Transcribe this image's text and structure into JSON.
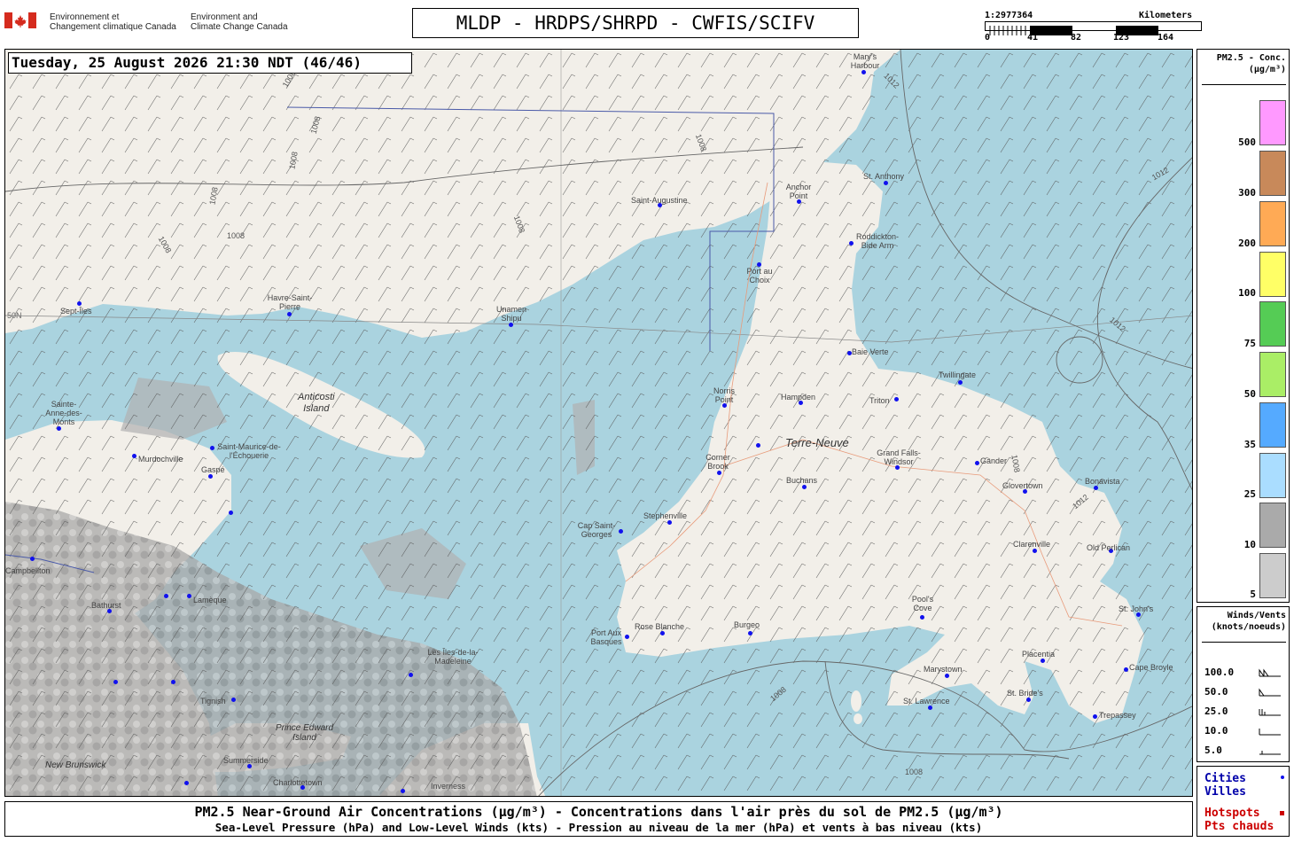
{
  "header": {
    "agency_fr_line1": "Environnement et",
    "agency_fr_line2": "Changement climatique Canada",
    "agency_en_line1": "Environment and",
    "agency_en_line2": "Climate Change Canada",
    "title": "MLDP - HRDPS/SHRPD - CWFIS/SCIFV"
  },
  "scale_bar": {
    "ratio": "1:2977364",
    "unit": "Kilometers",
    "ticks": [
      "0",
      "41",
      "82",
      "123",
      "164"
    ]
  },
  "map": {
    "timestamp": "Tuesday, 25 August 2026 21:30 NDT (46/46)",
    "cities": [
      {
        "name": "Mary's Harbour"
      },
      {
        "name": "St. Anthony"
      },
      {
        "name": "Anchor Point"
      },
      {
        "name": "Saint-Augustine"
      },
      {
        "name": "Roddickton-Bide Arm"
      },
      {
        "name": "Port au Choix"
      },
      {
        "name": "Sept-Îles"
      },
      {
        "name": "Havre-Saint-Pierre"
      },
      {
        "name": "Unamen Shipu"
      },
      {
        "name": "Baie Verte"
      },
      {
        "name": "Twillingate"
      },
      {
        "name": "Norris Point"
      },
      {
        "name": "Hampden"
      },
      {
        "name": "Triton"
      },
      {
        "name": "Sainte-Anne-des-Monts"
      },
      {
        "name": "Murdochville"
      },
      {
        "name": "Saint-Maurice-de-l'Échouerie"
      },
      {
        "name": "Gaspé"
      },
      {
        "name": "Corner Brook"
      },
      {
        "name": "Grand Falls-Windsor"
      },
      {
        "name": "Gander"
      },
      {
        "name": "Buchans"
      },
      {
        "name": "Glovertown"
      },
      {
        "name": "Bonavista"
      },
      {
        "name": "Cap Saint-Georges"
      },
      {
        "name": "Stephenville"
      },
      {
        "name": "Clarenville"
      },
      {
        "name": "Old Perlican"
      },
      {
        "name": "Campbellton"
      },
      {
        "name": "Bathurst"
      },
      {
        "name": "Lamèque"
      },
      {
        "name": "Pool's Cove"
      },
      {
        "name": "St. John's"
      },
      {
        "name": "Port Aux Basques"
      },
      {
        "name": "Rose Blanche"
      },
      {
        "name": "Burgeo"
      },
      {
        "name": "Placentia"
      },
      {
        "name": "Les Îles-de-la-Madeleine"
      },
      {
        "name": "Marystown"
      },
      {
        "name": "Cape Broyle"
      },
      {
        "name": "Tignish"
      },
      {
        "name": "St. Bride's"
      },
      {
        "name": "St. Lawrence"
      },
      {
        "name": "Trepassey"
      },
      {
        "name": "Summerside"
      },
      {
        "name": "Charlottetown"
      },
      {
        "name": "Inverness"
      }
    ],
    "regions": {
      "anticosti_line1": "Anticosti",
      "anticosti_line2": "Island",
      "terre_neuve": "Terre-Neuve",
      "new_brunswick": "New Brunswick",
      "pei": "Prince Edward",
      "pei2": "Island"
    },
    "isobars": [
      "1008",
      "1008",
      "1008",
      "1008",
      "1008",
      "1008",
      "1008",
      "1008",
      "1012",
      "1012",
      "1012",
      "1012",
      "1008",
      "1008",
      "1008"
    ],
    "latitude_label": "50N"
  },
  "pm25_legend": {
    "title_line1": "PM2.5 - Conc.",
    "title_line2": "(µg/m³)",
    "levels": [
      {
        "label": "500",
        "color": "#ff99ff"
      },
      {
        "label": "300",
        "color": "#c8895a"
      },
      {
        "label": "200",
        "color": "#ffaa55"
      },
      {
        "label": "100",
        "color": "#ffff66"
      },
      {
        "label": "75",
        "color": "#55cc55"
      },
      {
        "label": "50",
        "color": "#aaee66"
      },
      {
        "label": "35",
        "color": "#55aaff"
      },
      {
        "label": "25",
        "color": "#aaddff"
      },
      {
        "label": "10",
        "color": "#aaaaaa"
      },
      {
        "label": "5",
        "color": "#cccccc"
      }
    ]
  },
  "wind_legend": {
    "title_line1": "Winds/Vents",
    "title_line2": "(knots/noeuds)",
    "speeds": [
      "100.0",
      "50.0",
      "25.0",
      "10.0",
      "5.0"
    ]
  },
  "cities_legend": {
    "cities_en": "Cities",
    "cities_fr": "Villes",
    "hotspots_en": "Hotspots",
    "hotspots_fr": "Pts chauds"
  },
  "footer": {
    "line1": "PM2.5 Near-Ground Air Concentrations (µg/m³) - Concentrations dans l'air près du sol de PM2.5 (µg/m³)",
    "line2": "Sea-Level Pressure (hPa) and Low-Level Winds (kts) - Pression au niveau de la mer (hPa) et vents à bas niveau (kts)"
  },
  "colors": {
    "water": "#aad3df",
    "land": "#f2efe9",
    "smoke_dark": "#9a9a9a",
    "smoke_light": "#c8c8c8",
    "city_dot": "#1111ee",
    "hotspot": "#cc0000"
  }
}
